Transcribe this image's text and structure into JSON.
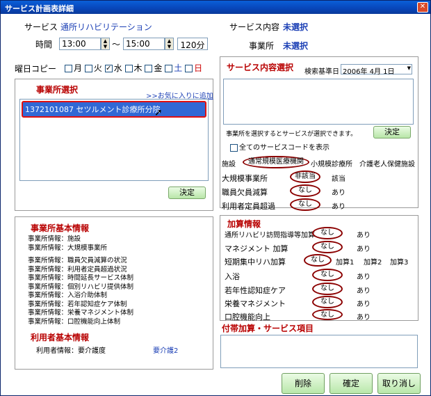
{
  "window": {
    "title": "サービス計画表詳細"
  },
  "service": {
    "label": "サービス",
    "value": "通所リハビリテーション"
  },
  "service_content": {
    "label": "サービス内容",
    "value": "未選択"
  },
  "office": {
    "label": "事業所",
    "value": "未選択"
  },
  "time": {
    "label": "時間",
    "start": "13:00",
    "sep": "〜",
    "end": "15:00",
    "duration": "120分"
  },
  "weekday_copy": {
    "label": "曜日コピー",
    "days": [
      {
        "label": "月",
        "checked": false
      },
      {
        "label": "火",
        "checked": false
      },
      {
        "label": "水",
        "checked": true
      },
      {
        "label": "木",
        "checked": false
      },
      {
        "label": "金",
        "checked": false
      },
      {
        "label": "土",
        "checked": false
      },
      {
        "label": "日",
        "checked": false
      }
    ]
  },
  "office_select": {
    "title": "事業所選択",
    "favorite_link": ">>お気に入りに追加",
    "items": [
      "1372101087 セツルメント診療所分院"
    ],
    "confirm": "決定"
  },
  "service_select": {
    "title": "サービス内容選択",
    "base_date_label": "検索基準日",
    "base_date": "2006年 4月 1日",
    "hint": "事業所を選択するとサービスが選択できます。",
    "confirm": "決定",
    "show_all": "全てのサービスコードを表示",
    "facility_label": "施設",
    "facility_options": [
      "通常規模医療機関",
      "小規模診療所",
      "介護老人保健施設"
    ],
    "rows": [
      {
        "label": "大規模事業所",
        "options": [
          "非該当",
          "該当"
        ]
      },
      {
        "label": "職員欠員減算",
        "options": [
          "なし",
          "あり"
        ]
      },
      {
        "label": "利用者定員超過",
        "options": [
          "なし",
          "あり"
        ]
      }
    ]
  },
  "office_info": {
    "title": "事業所基本情報",
    "lines": [
      "事業所情報：施設",
      "事業所情報：大規模事業所",
      "",
      "事業所情報：職員欠員減算の状況",
      "事業所情報：利用者定員超過状況",
      "事業所情報：時間延長サービス体制",
      "事業所情報：個別リハビリ提供体制",
      "事業所情報：入浴介助体制",
      "事業所情報：若年認知症ケア体制",
      "事業所情報：栄養マネジメント体制",
      "事業所情報：口腔機能向上体制"
    ]
  },
  "user_info": {
    "title": "利用者基本情報",
    "label": "利用者情報：要介護度",
    "value": "要介護2"
  },
  "addition": {
    "title": "加算情報",
    "rows": [
      {
        "label": "通所リハビリ訪問指導等加算",
        "options": [
          "なし",
          "あり"
        ]
      },
      {
        "label": "マネジメント 加算",
        "options": [
          "なし",
          "あり"
        ]
      },
      {
        "label": "短期集中リハ加算",
        "options": [
          "なし",
          "加算1",
          "加算2",
          "加算3"
        ]
      },
      {
        "label": "入浴",
        "options": [
          "なし",
          "あり"
        ]
      },
      {
        "label": "若年性認知症ケア",
        "options": [
          "なし",
          "あり"
        ]
      },
      {
        "label": "栄養マネジメント",
        "options": [
          "なし",
          "あり"
        ]
      },
      {
        "label": "口腔機能向上",
        "options": [
          "なし",
          "あり"
        ]
      }
    ]
  },
  "extra": {
    "title": "付帯加算・サービス項目"
  },
  "buttons": {
    "delete": "削除",
    "confirm": "確定",
    "cancel": "取り消し"
  }
}
